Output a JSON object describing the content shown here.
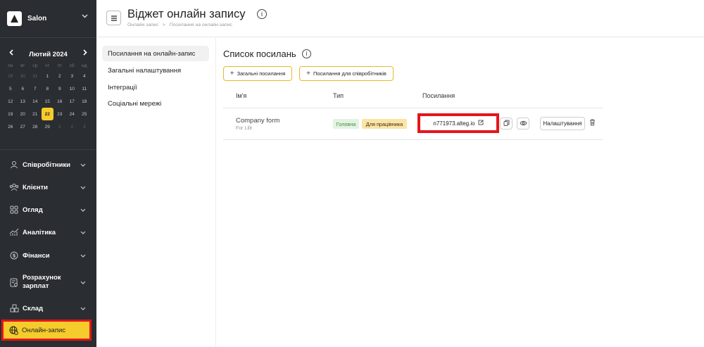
{
  "sidebar": {
    "brand": "Salon",
    "calendar": {
      "month": "Лютий 2024",
      "weekdays": [
        "пн",
        "вт",
        "ср",
        "чт",
        "пт",
        "сб",
        "нд"
      ],
      "days": [
        "29",
        "30",
        "31",
        "1",
        "2",
        "3",
        "4",
        "5",
        "6",
        "7",
        "8",
        "9",
        "10",
        "11",
        "12",
        "13",
        "14",
        "15",
        "16",
        "17",
        "18",
        "19",
        "20",
        "21",
        "22",
        "23",
        "24",
        "25",
        "26",
        "27",
        "28",
        "29",
        "1",
        "2",
        "3"
      ],
      "today": "22"
    },
    "nav": [
      {
        "label": "Співробітники",
        "icon": "user-icon"
      },
      {
        "label": "Клієнти",
        "icon": "clients-icon"
      },
      {
        "label": "Огляд",
        "icon": "grid-icon"
      },
      {
        "label": "Аналітика",
        "icon": "analytics-icon"
      },
      {
        "label": "Фінанси",
        "icon": "finance-icon"
      },
      {
        "label": "Розрахунок зарплат",
        "icon": "payroll-icon"
      },
      {
        "label": "Склад",
        "icon": "warehouse-icon"
      },
      {
        "label": "Онлайн-запис",
        "icon": "globe-icon"
      }
    ]
  },
  "header": {
    "title": "Віджет онлайн запису",
    "breadcrumbs": [
      "Онлайн запис",
      "Посилання на онлайн-запис"
    ],
    "separator": ">"
  },
  "subnav": [
    {
      "label": "Посилання на онлайн-запис",
      "active": true
    },
    {
      "label": "Загальні налаштування",
      "active": false
    },
    {
      "label": "Інтеграції",
      "active": false
    },
    {
      "label": "Соціальні мережі",
      "active": false
    }
  ],
  "main": {
    "title": "Список посилань",
    "buttons": {
      "general": "Загальні посилання",
      "staff": "Посилання для співробітників"
    },
    "columns": [
      "Ім'я",
      "Тип",
      "Посилання"
    ],
    "rows": [
      {
        "name": "Company form",
        "subtitle": "For Lilit",
        "tags": [
          "Головна",
          "Для працівника"
        ],
        "link": "n771973.alteg.io",
        "settings": "Налаштування"
      }
    ]
  },
  "colors": {
    "sidebar_bg": "#2a2d31",
    "accent": "#f5cc2b",
    "highlight": "#e3161b"
  }
}
